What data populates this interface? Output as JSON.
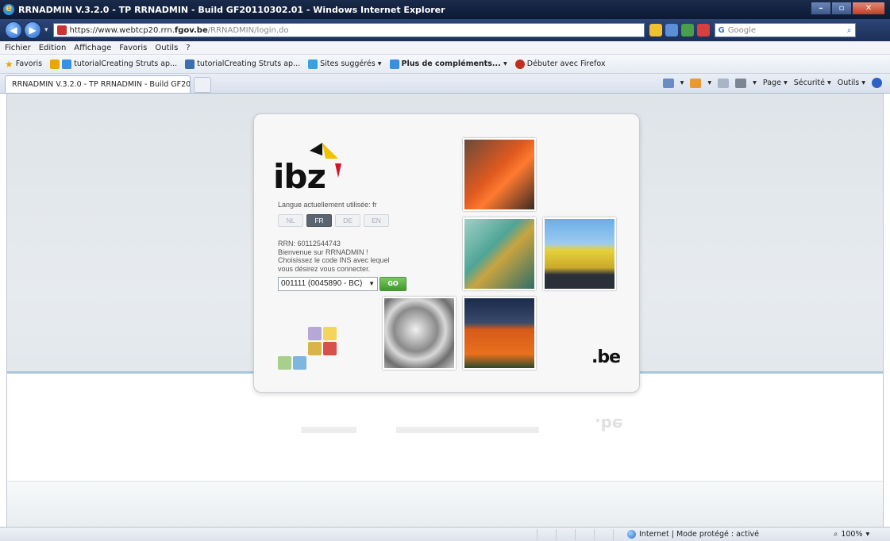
{
  "window": {
    "title": "RRNADMIN V.3.2.0 - TP RRNADMIN - Build GF20110302.01 - Windows Internet Explorer"
  },
  "addressbar": {
    "url_prefix": "https://www.webtcp20.rrn.",
    "url_host": "fgov.be",
    "url_path": "/RRNADMIN/login.do",
    "search_placeholder": "Google"
  },
  "menu": {
    "items": [
      "Fichier",
      "Edition",
      "Affichage",
      "Favoris",
      "Outils",
      "?"
    ]
  },
  "favorites": {
    "label": "Favoris",
    "links": [
      "tutorialCreating Struts ap...",
      "tutorialCreating Struts ap...",
      "Sites suggérés ▾",
      "Plus de compléments... ▾",
      "Débuter avec Firefox"
    ]
  },
  "tab": {
    "title": "RRNADMIN V.3.2.0 - TP RRNADMIN - Build GF20..."
  },
  "commandbar": {
    "page": "Page ▾",
    "security": "Sécurité ▾",
    "tools": "Outils ▾"
  },
  "login": {
    "logo_text": "ibz",
    "lang_label": "Langue actuellement utilisée: fr",
    "languages": [
      "NL",
      "FR",
      "DE",
      "EN"
    ],
    "active_language": "FR",
    "rrn_line": "RRN: 60112544743",
    "welcome_line": "Bienvenue sur RRNADMIN !",
    "choose_line1": "Choisissez le code INS avec lequel",
    "choose_line2": "vous désirez vous connecter.",
    "ins_selected": "001111 (0045890 - BC)",
    "go_label": "GO",
    "be_label": ".be"
  },
  "statusbar": {
    "zone": "Internet | Mode protégé : activé",
    "zoom": "100%"
  },
  "colors": {
    "accent_green": "#3e9a2b",
    "flag_black": "#111111",
    "flag_yellow": "#f2c200",
    "flag_red": "#d4142a"
  }
}
